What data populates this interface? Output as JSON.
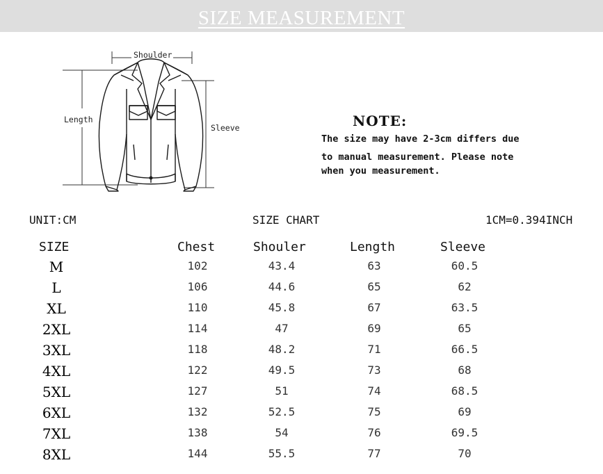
{
  "banner": {
    "title": "SIZE MEASUREMENT"
  },
  "diagram": {
    "shoulder": "Shoulder",
    "length": "Length",
    "sleeve": "Sleeve"
  },
  "note": {
    "heading": "NOTE:",
    "lines": [
      "The size may have 2-3cm differs due",
      "to manual measurement. Please note",
      "when you measurement."
    ]
  },
  "info": {
    "unit": "UNIT:CM",
    "chart_title": "SIZE CHART",
    "conversion": "1CM=0.394INCH"
  },
  "table": {
    "headers": [
      "SIZE",
      "Chest",
      "Shouler",
      "Length",
      "Sleeve"
    ],
    "rows": [
      [
        "M",
        "102",
        "43.4",
        "63",
        "60.5"
      ],
      [
        "L",
        "106",
        "44.6",
        "65",
        "62"
      ],
      [
        "XL",
        "110",
        "45.8",
        "67",
        "63.5"
      ],
      [
        "2XL",
        "114",
        "47",
        "69",
        "65"
      ],
      [
        "3XL",
        "118",
        "48.2",
        "71",
        "66.5"
      ],
      [
        "4XL",
        "122",
        "49.5",
        "73",
        "68"
      ],
      [
        "5XL",
        "127",
        "51",
        "74",
        "68.5"
      ],
      [
        "6XL",
        "132",
        "52.5",
        "75",
        "69"
      ],
      [
        "7XL",
        "138",
        "54",
        "76",
        "69.5"
      ],
      [
        "8XL",
        "144",
        "55.5",
        "77",
        "70"
      ]
    ]
  }
}
